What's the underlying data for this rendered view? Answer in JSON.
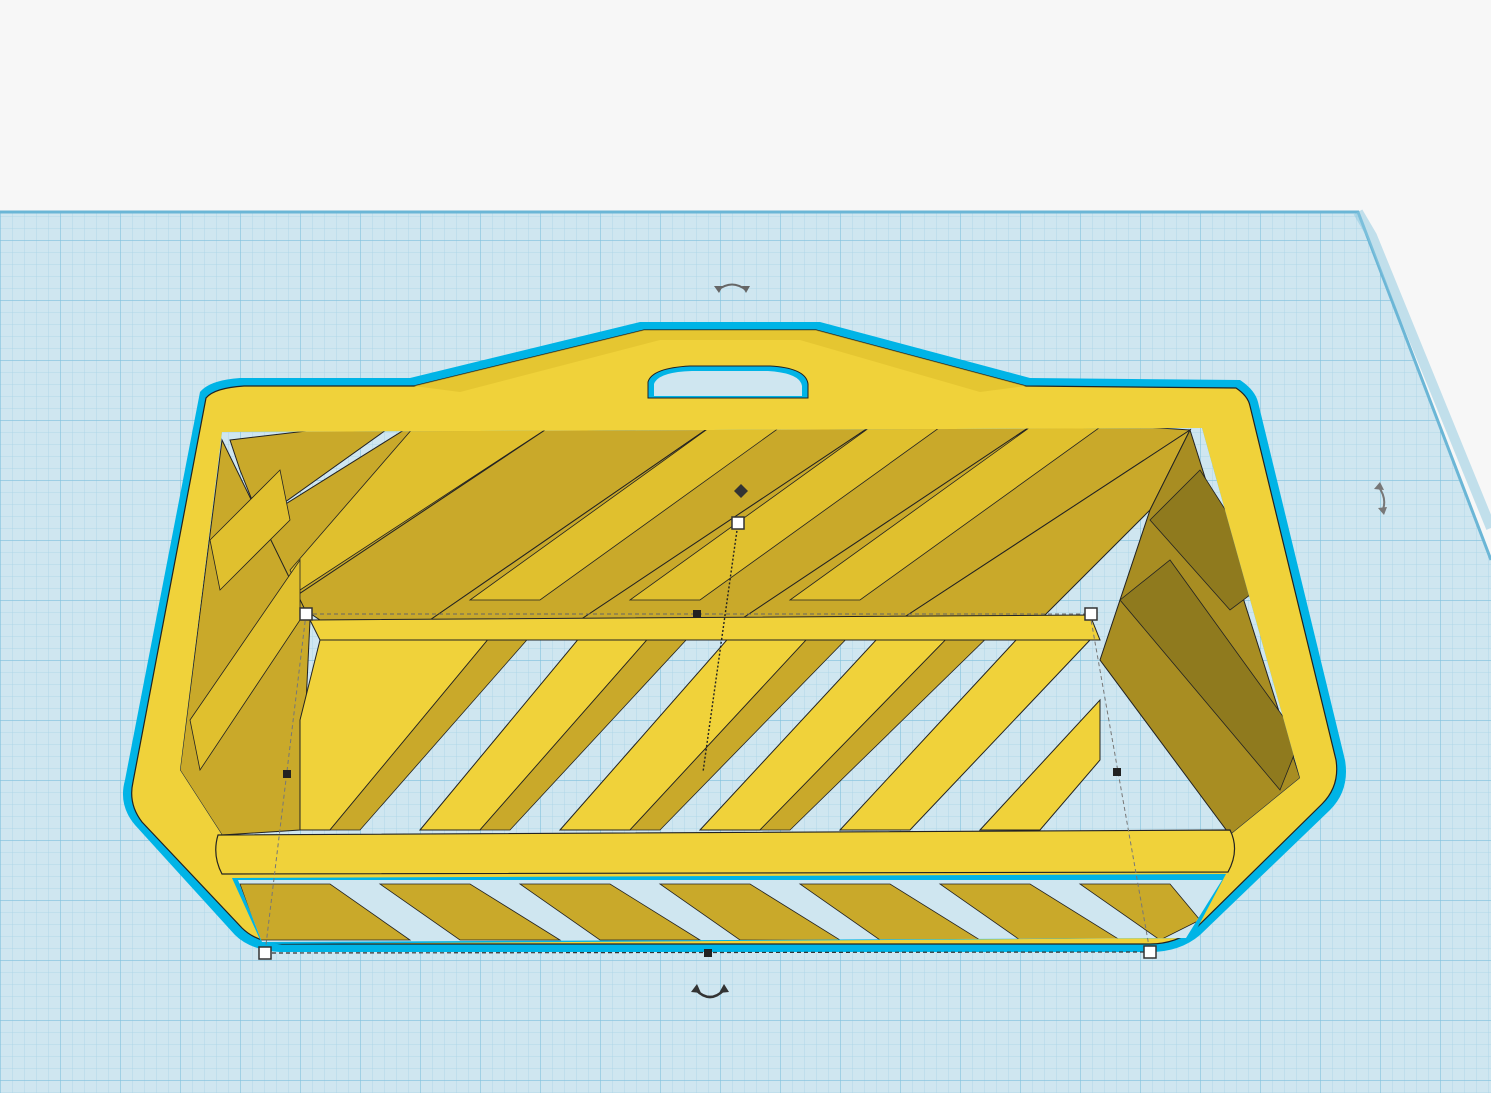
{
  "app": {
    "view": "3D workplane"
  },
  "scene": {
    "workplane": {
      "color": "#cfe6f0",
      "minor_grid": "#a9d3e6",
      "major_grid": "#7fc0dc",
      "edge": "#6bb6d6"
    },
    "object": {
      "name": "basket",
      "fill": "#f0d23a",
      "shade": "#c9a92a",
      "dark": "#8f7a1e",
      "outline": "#00b4e6",
      "edge": "#222222"
    },
    "selection": {
      "handle_fill": "#ffffff",
      "handle_stroke": "#333333"
    },
    "icons": [
      "rotate-arrow-icon",
      "rotate-arrow-icon",
      "rotate-arrow-icon"
    ]
  }
}
